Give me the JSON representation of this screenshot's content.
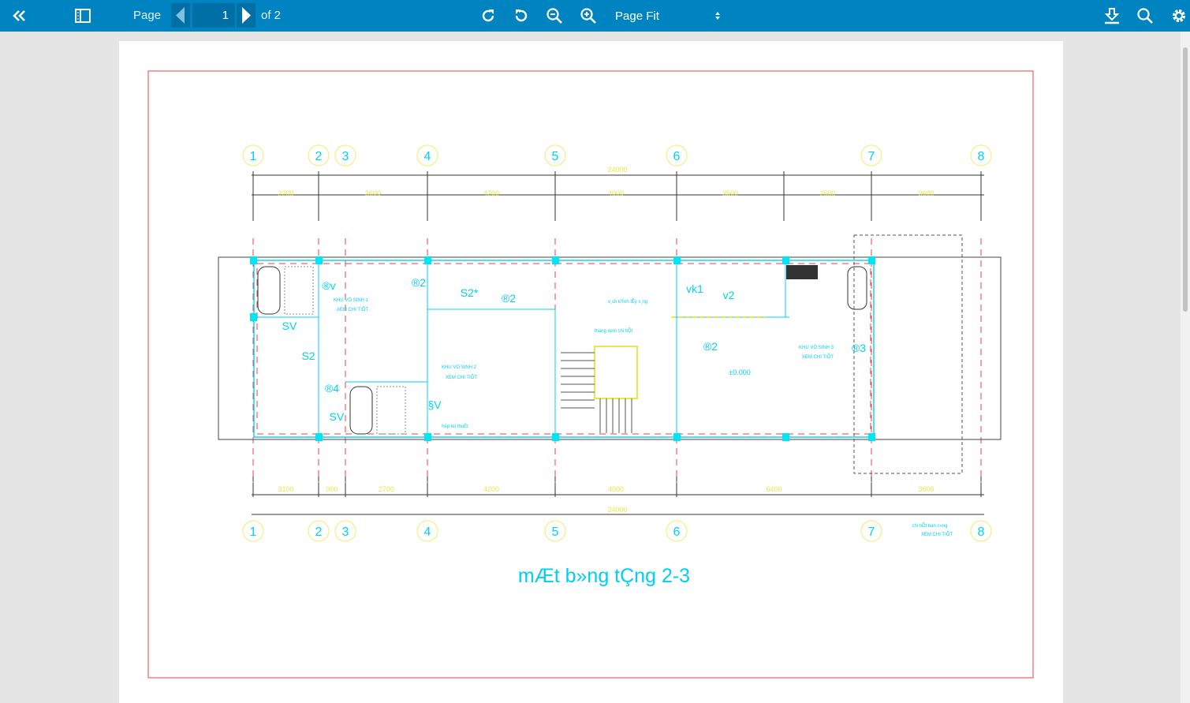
{
  "toolbar": {
    "collapse_icon": "double-chevron-left-icon",
    "sidebar_icon": "sidebar-toggle-icon",
    "page_label": "Page",
    "page_value": "1",
    "page_total": "of 2",
    "zoom_mode": "Page Fit",
    "icons": [
      "rotate-clockwise-icon",
      "rotate-counterclockwise-icon",
      "zoom-out-icon",
      "zoom-in-icon",
      "download-icon",
      "search-icon",
      "gear-icon"
    ]
  },
  "colors": {
    "toolbar": "#0083c1",
    "border": "#e8414a",
    "cyan": "#00d2f0",
    "yellow": "#e8e84a"
  },
  "drawing": {
    "title": "mÆt b»ng tÇng 2-3",
    "grid_labels": [
      "1",
      "2",
      "3",
      "4",
      "5",
      "6",
      "7",
      "8"
    ],
    "top_total": "24000",
    "top_dims": [
      "2200",
      "3600",
      "4200",
      "4000",
      "3500",
      "2600",
      "3600"
    ],
    "bottom_total": "24000",
    "bottom_dims": [
      "3100",
      "900",
      "2700",
      "4200",
      "4000",
      "6400",
      "3600"
    ],
    "rooms": [
      "®v",
      "®2",
      "S2*",
      "®2",
      "SV",
      "S2",
      "®4",
      "SV",
      "§V",
      "vk1",
      "v2",
      "®2",
      "®3",
      "±0.000"
    ],
    "notes": [
      "KHU VÖ SINH 1",
      "XEM CHI TIÕT",
      "KHU VÖ SINH 2",
      "XEM CHI TIÕT",
      "KHU VÖ SINH 3",
      "XEM CHI TIÕT",
      "v¸ch kÝnh lÊy s¸ng",
      "thang xem chi tiÕt",
      "hép kü thuËt",
      "chi tiÕt ban c«ng",
      "XEM CHI TIÕT"
    ]
  }
}
